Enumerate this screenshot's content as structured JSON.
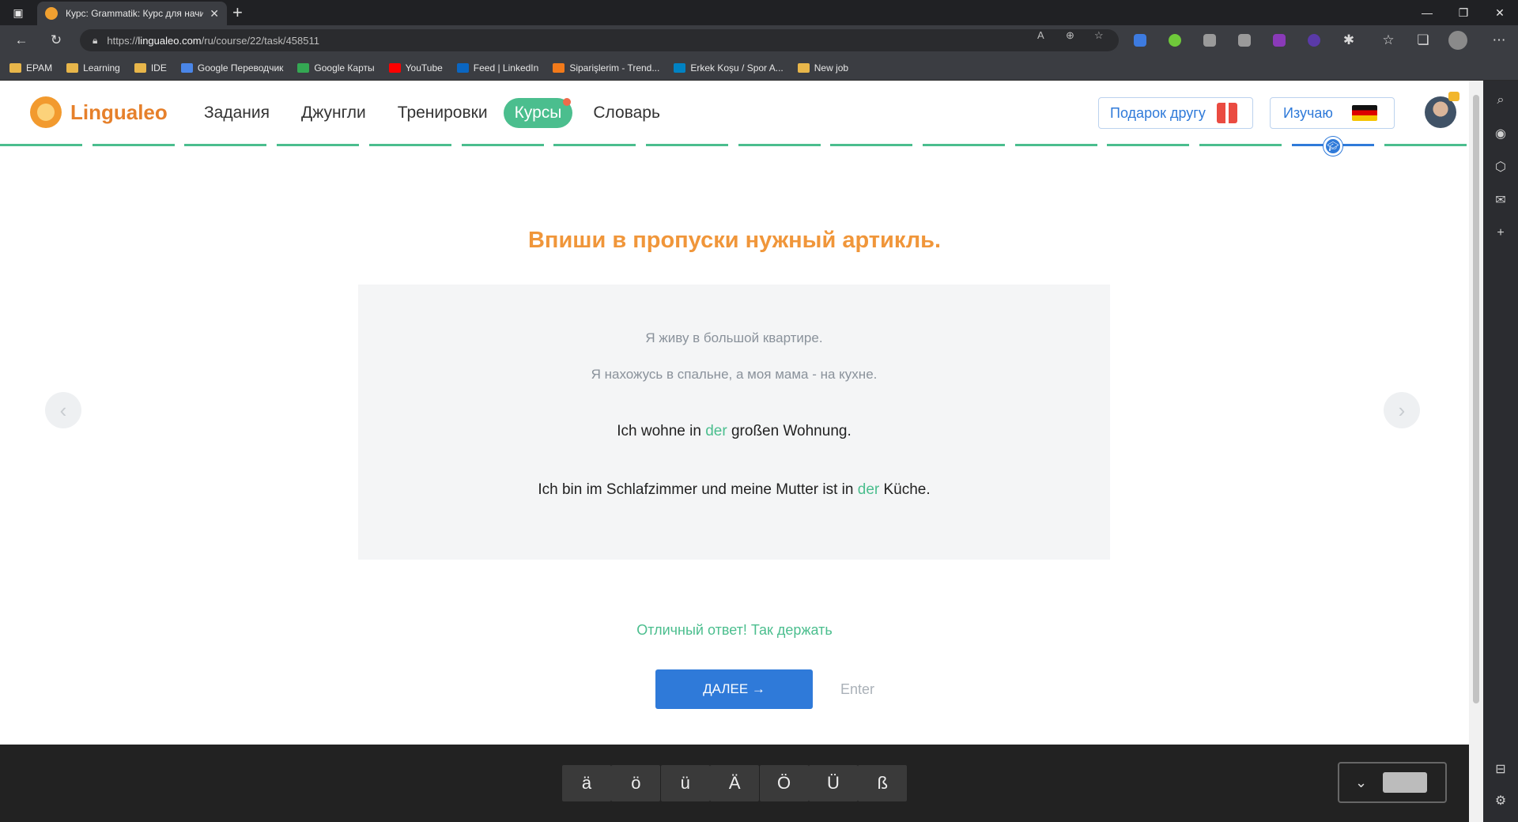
{
  "browser": {
    "tab_title": "Курс: Grammatik: Курс для начи",
    "url_prefix": "https://",
    "url_domain": "lingualeo.com",
    "url_path": "/ru/course/22/task/458511",
    "bookmarks": [
      {
        "label": "EPAM",
        "icon": "folder-icon",
        "color": "#e8b64a"
      },
      {
        "label": "Learning",
        "icon": "folder-icon",
        "color": "#e8b64a"
      },
      {
        "label": "IDE",
        "icon": "folder-icon",
        "color": "#e8b64a"
      },
      {
        "label": "Google Переводчик",
        "icon": "google-translate-icon",
        "color": "#4a86e8"
      },
      {
        "label": "Google Карты",
        "icon": "google-maps-icon",
        "color": "#34a853"
      },
      {
        "label": "YouTube",
        "icon": "youtube-icon",
        "color": "#ff0000"
      },
      {
        "label": "Feed | LinkedIn",
        "icon": "linkedin-icon",
        "color": "#0a66c2"
      },
      {
        "label": "Siparişlerim - Trend...",
        "icon": "trendyol-icon",
        "color": "#f27a1a"
      },
      {
        "label": "Erkek Koşu / Spor A...",
        "icon": "decathlon-icon",
        "color": "#0082c3"
      },
      {
        "label": "New job",
        "icon": "folder-icon",
        "color": "#e8b64a"
      }
    ]
  },
  "site": {
    "brand": "Lingualeo",
    "nav": [
      {
        "label": "Задания",
        "active": false
      },
      {
        "label": "Джунгли",
        "active": false
      },
      {
        "label": "Тренировки",
        "active": false
      },
      {
        "label": "Курсы",
        "active": true
      },
      {
        "label": "Словарь",
        "active": false
      }
    ],
    "gift_label": "Подарок другу",
    "learning_label": "Изучаю",
    "accent_green": "#4bbe8e",
    "accent_blue": "#2f7ad9"
  },
  "task": {
    "title": "Впиши в пропуски нужный артикль.",
    "translations": [
      "Я живу в большой квартире.",
      "Я нахожусь в спальне, а моя мама - на кухне."
    ],
    "sentence1": {
      "before": "Ich wohne in ",
      "answer": "der",
      "after": " großen Wohnung."
    },
    "sentence2": {
      "before": "Ich bin im Schlafzimmer und meine Mutter ist in ",
      "answer": "der",
      "after": " Küche."
    },
    "feedback": "Отличный ответ! Так держать",
    "next_label": "ДАЛЕЕ →",
    "enter_hint": "Enter"
  },
  "keyboard": {
    "keys": [
      "ä",
      "ö",
      "ü",
      "Ä",
      "Ö",
      "Ü",
      "ß"
    ]
  }
}
